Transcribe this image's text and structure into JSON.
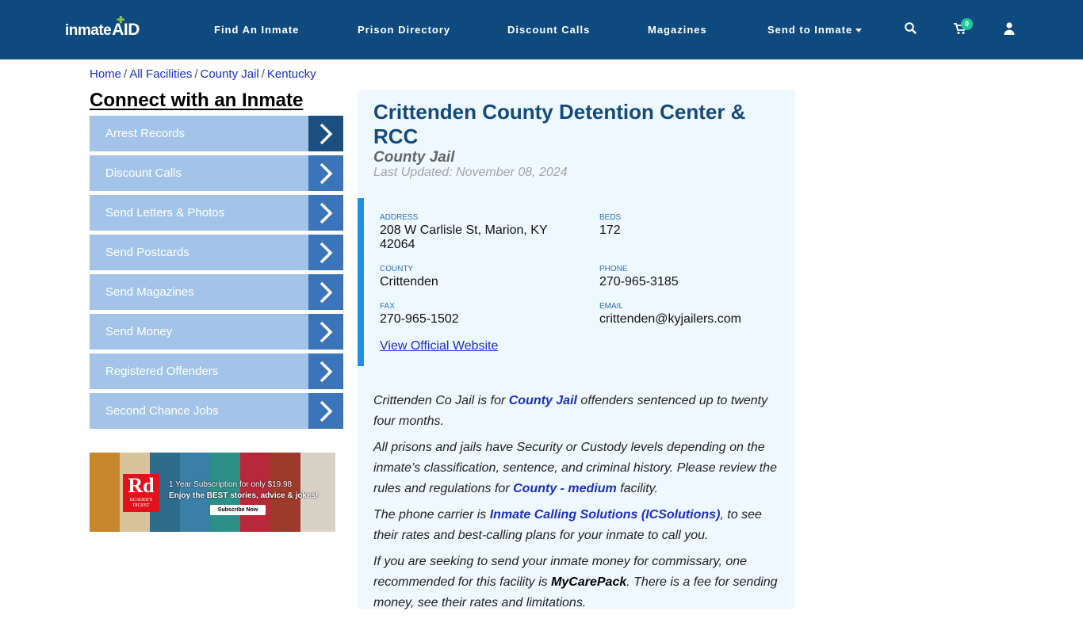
{
  "header": {
    "logo": {
      "text_inmate": "inmate",
      "text_aid": "AID"
    },
    "nav": [
      {
        "label": "Find An Inmate"
      },
      {
        "label": "Prison Directory"
      },
      {
        "label": "Discount Calls"
      },
      {
        "label": "Magazines"
      },
      {
        "label": "Send to Inmate",
        "has_dropdown": true
      }
    ],
    "icons": {
      "search": "search-icon",
      "cart": "cart-icon",
      "user": "user-icon"
    },
    "cart_count": "0"
  },
  "breadcrumb": {
    "items": [
      "Home",
      "All Facilities",
      "County Jail",
      "Kentucky"
    ],
    "separator": "/"
  },
  "sidebar": {
    "title": "Connect with an Inmate",
    "items": [
      {
        "label": "Arrest Records"
      },
      {
        "label": "Discount Calls"
      },
      {
        "label": "Send Letters & Photos"
      },
      {
        "label": "Send Postcards"
      },
      {
        "label": "Send Magazines"
      },
      {
        "label": "Send Money"
      },
      {
        "label": "Registered Offenders"
      },
      {
        "label": "Second Chance Jobs"
      }
    ],
    "ad": {
      "logo": "Rd",
      "logo_sub": "READER'S DIGEST",
      "line1": "1 Year Subscription for only $19.98",
      "line2": "Enjoy the BEST stories, advice & jokes!",
      "button": "Subscribe Now"
    }
  },
  "facility": {
    "name": "Crittenden County Detention Center & RCC",
    "type": "County Jail",
    "last_updated": "Last Updated: November 08, 2024",
    "fields": {
      "address": {
        "label": "ADDRESS",
        "value": "208 W Carlisle St, Marion, KY 42064"
      },
      "beds": {
        "label": "BEDS",
        "value": "172"
      },
      "county": {
        "label": "COUNTY",
        "value": "Crittenden"
      },
      "phone": {
        "label": "PHONE",
        "value": "270-965-3185"
      },
      "fax": {
        "label": "FAX",
        "value": "270-965-1502"
      },
      "email": {
        "label": "EMAIL",
        "value": "crittenden@kyjailers.com"
      }
    },
    "official_link": "View Official Website",
    "description": {
      "p1": {
        "before": "Crittenden Co Jail is for ",
        "link": "County Jail",
        "after": " offenders sentenced up to twenty four months."
      },
      "p2": {
        "before": "All prisons and jails have Security or Custody levels depending on the inmate’s classification, sentence, and criminal history. Please review the rules and regulations for ",
        "link": "County - medium",
        "after": " facility."
      },
      "p3": {
        "before": "The phone carrier is ",
        "link": "Inmate Calling Solutions (ICSolutions)",
        "after": ", to see their rates and best-calling plans for your inmate to call you."
      },
      "p4": {
        "before": "If you are seeking to send your inmate money for commissary, one recommended for this facility is ",
        "bold": "MyCarePack",
        "after": ". There is a fee for sending money, see their rates and limitations."
      }
    }
  }
}
